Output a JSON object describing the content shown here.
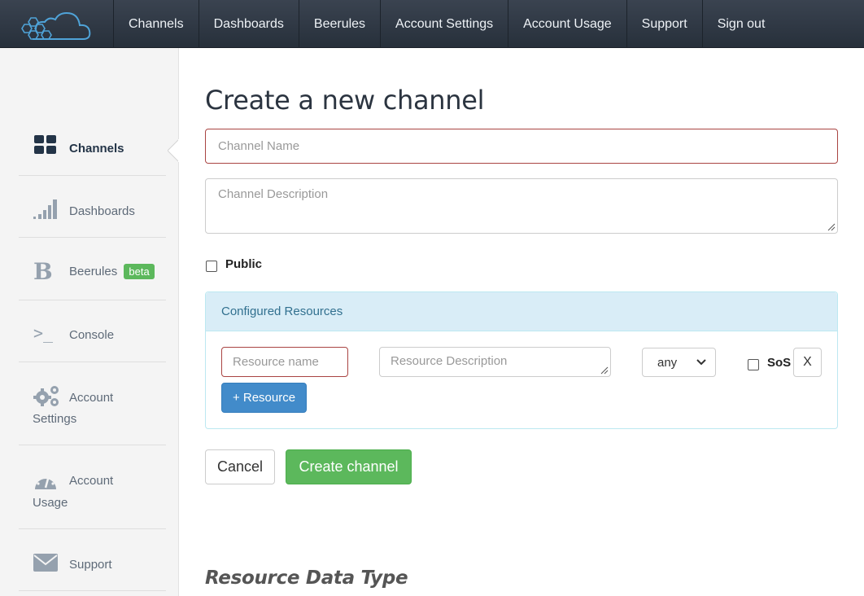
{
  "nav": {
    "items": [
      "Channels",
      "Dashboards",
      "Beerules",
      "Account Settings",
      "Account Usage",
      "Support",
      "Sign out"
    ]
  },
  "sidebar": {
    "items": [
      {
        "label": "Channels",
        "icon": "grid-icon"
      },
      {
        "label": "Dashboards",
        "icon": "signal-bars-icon"
      },
      {
        "label": "Beerules",
        "icon": "beerules-b-icon",
        "badge": "beta"
      },
      {
        "label": "Console",
        "icon": "terminal-icon"
      },
      {
        "label": "Account",
        "label2": "Settings",
        "icon": "gears-icon"
      },
      {
        "label": "Account",
        "label2": "Usage",
        "icon": "speedometer-icon"
      },
      {
        "label": "Support",
        "icon": "envelope-icon"
      }
    ]
  },
  "form": {
    "title": "Create a new channel",
    "name_placeholder": "Channel Name",
    "description_placeholder": "Channel Description",
    "public_label": "Public",
    "resources": {
      "header": "Configured Resources",
      "name_placeholder": "Resource name",
      "description_placeholder": "Resource Description",
      "type_value": "any",
      "sos_label": "SoS",
      "remove_label": "X",
      "add_label": "+ Resource"
    },
    "cancel_label": "Cancel",
    "create_label": "Create channel"
  },
  "section": {
    "data_type_title": "Resource Data Type"
  },
  "colors": {
    "nav_bg": "#2c3541",
    "sidebar_bg": "#f4f4f4",
    "primary": "#428bca",
    "success": "#5cb85c",
    "error_border": "#a94442",
    "info_bg": "#d9edf7"
  }
}
